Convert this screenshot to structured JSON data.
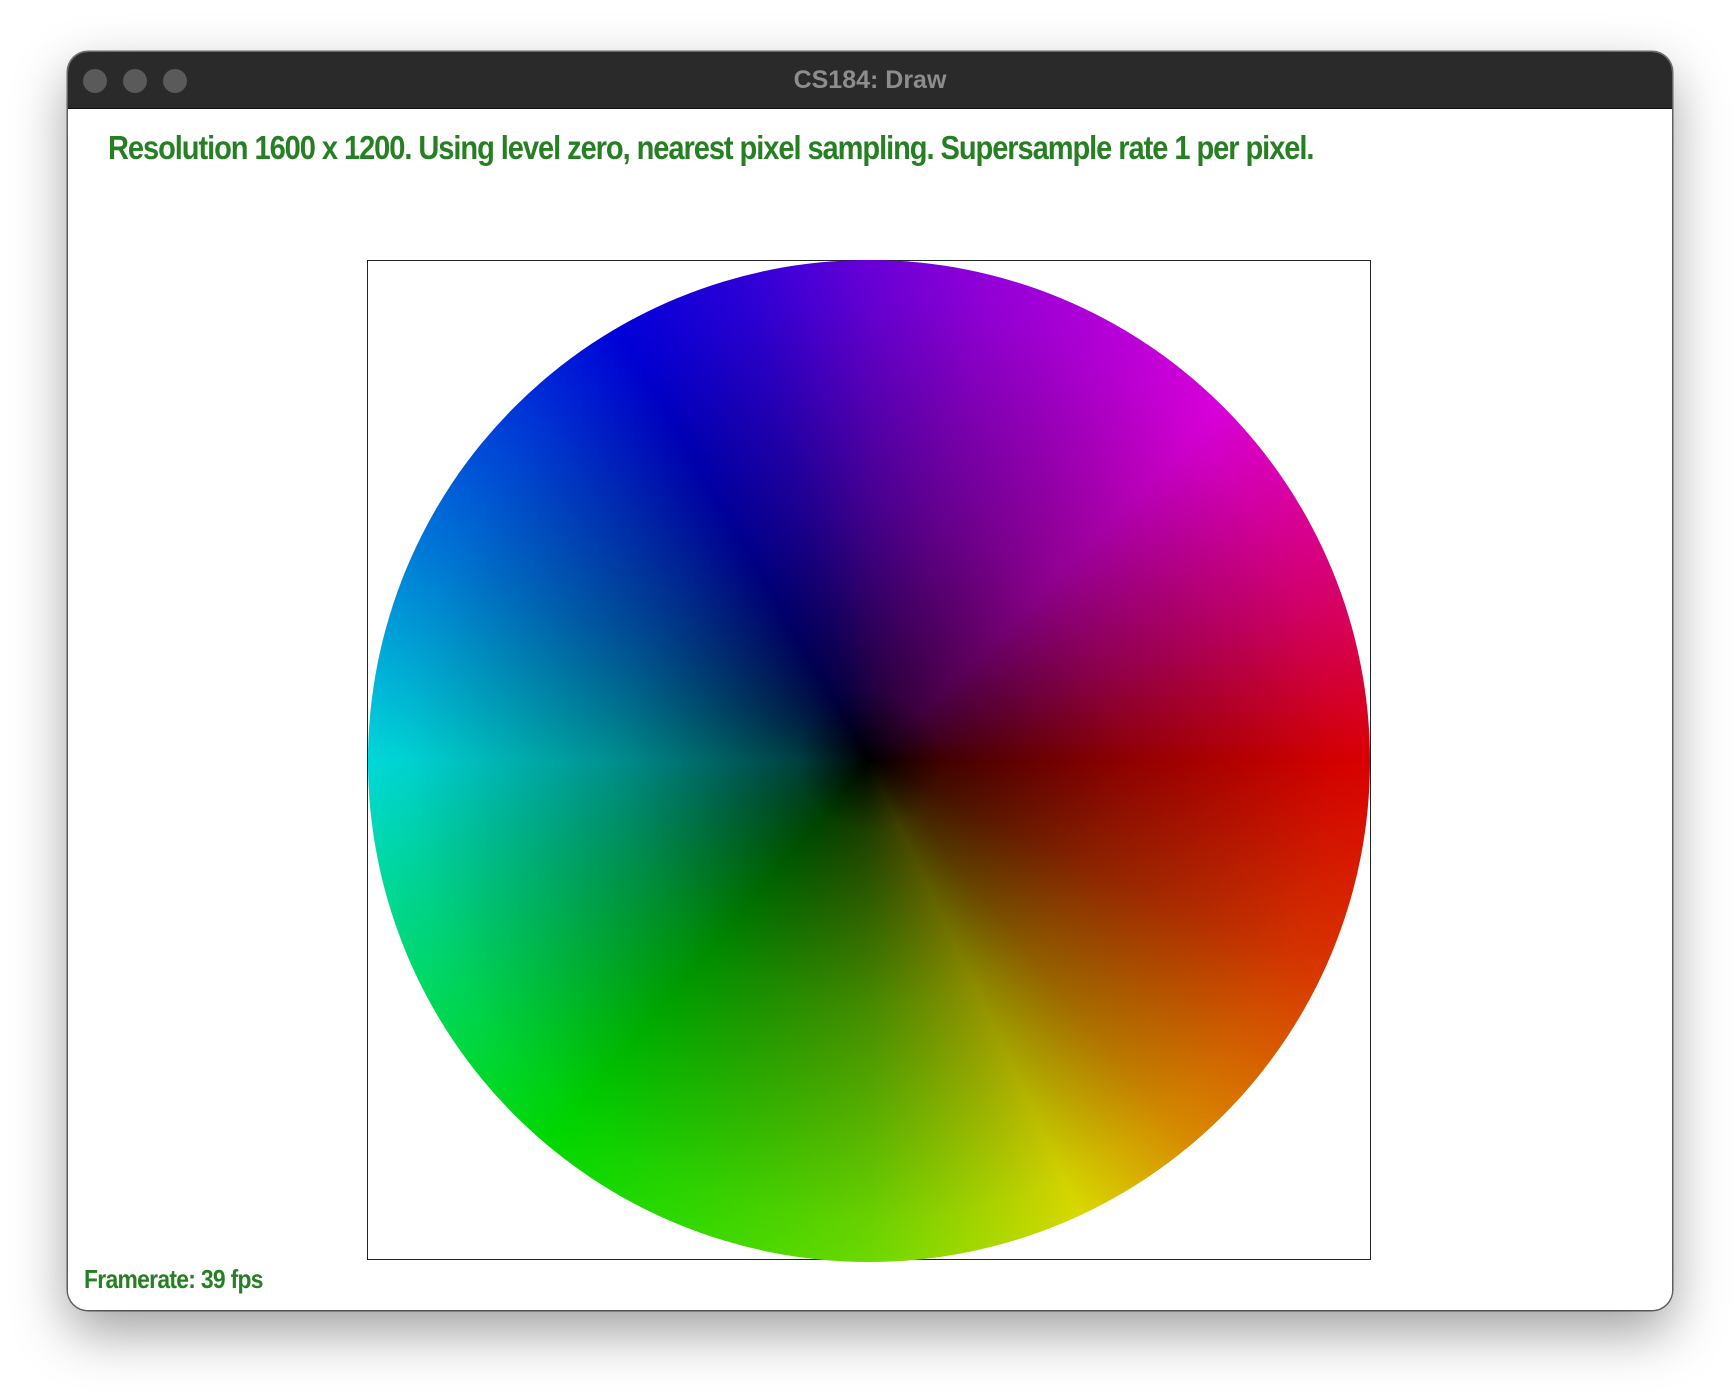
{
  "window": {
    "title": "CS184: Draw"
  },
  "status": {
    "text": "Resolution 1600 x 1200. Using level zero, nearest pixel sampling. Supersample rate 1 per pixel.",
    "color": "#267f22"
  },
  "footer": {
    "framerate": "Framerate: 39 fps"
  },
  "colors": {
    "titlebar": "#2a2a2a",
    "traffic_light": "#5a5a5a",
    "title_text": "#8d8d8d",
    "status_green": "#267f22"
  }
}
